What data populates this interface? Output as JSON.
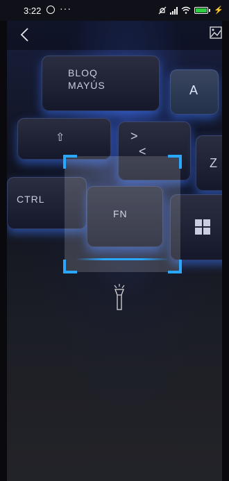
{
  "status_bar": {
    "time": "3:22",
    "more": "···",
    "battery_color": "#2ecc40"
  },
  "keyboard": {
    "keys": [
      "BLOQ\nMAYÚS",
      "A",
      "CTRL",
      "FN",
      "Z"
    ]
  },
  "scanner": {
    "accent_color": "#2aa8ff"
  },
  "icons": {
    "back": "back-arrow-icon",
    "gallery": "gallery-icon",
    "torch": "flashlight-icon"
  }
}
